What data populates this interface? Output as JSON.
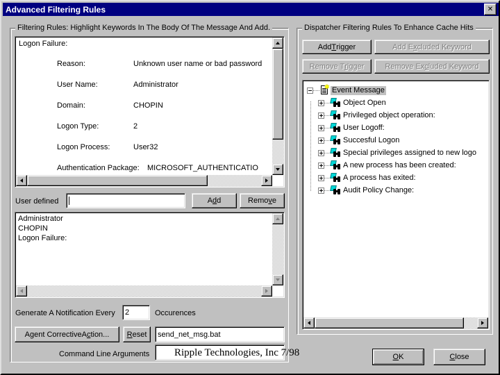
{
  "window": {
    "title": "Advanced Filtering Rules",
    "close_glyph": "✕",
    "titlebar_color": "#000080",
    "face_color": "#c0c0c0"
  },
  "left_group": {
    "title": "Filtering Rules: Highlight Keywords In The Body Of The Message And Add.",
    "message_view": {
      "header": "Logon Failure:",
      "rows": [
        {
          "label": "Reason:",
          "value": "Unknown user name or bad password"
        },
        {
          "label": "User Name:",
          "value": "Administrator"
        },
        {
          "label": "Domain:",
          "value": "CHOPIN"
        },
        {
          "label": "Logon Type:",
          "value": "2"
        },
        {
          "label": "Logon Process:",
          "value": "User32"
        },
        {
          "label": "Authentication Package:",
          "value": "MICROSOFT_AUTHENTICATIO"
        }
      ]
    },
    "user_defined_label": "User defined",
    "user_defined_value": "",
    "user_defined_placeholder": "",
    "add_button": {
      "pre": "A",
      "mnemonic": "d",
      "post": "d"
    },
    "remove_button": {
      "pre": "Remo",
      "mnemonic": "v",
      "post": "e"
    },
    "keyword_list": [
      "Administrator",
      "CHOPIN",
      "Logon Failure:"
    ],
    "notify_label": "Generate A Notification Every",
    "notify_value": "2",
    "occurrences_label": "Occurences",
    "agent_button": {
      "pre": "A",
      "mnemonic": "g",
      "post": "ent Corrective ",
      "pre2": "A",
      "mnemonic2": "c",
      "post2": "tion..."
    },
    "agent_button_text": "Agent Corrective Action...",
    "reset_button": {
      "mnemonic": "R",
      "post": "eset"
    },
    "script_value": "send_net_msg.bat",
    "command_line_label": "Command Line Arguments",
    "command_line_value": ""
  },
  "right_group": {
    "title": "Dispatcher Filtering Rules To Enhance Cache Hits",
    "buttons": [
      {
        "name": "add-trigger",
        "pre": "Add ",
        "mnemonic": "T",
        "post": "rigger",
        "disabled": false
      },
      {
        "name": "add-excluded-keyword",
        "pre": "Add E",
        "mnemonic": "x",
        "post": "cluded Keyword",
        "disabled": true
      },
      {
        "name": "remove-trigger",
        "pre": "Remove T",
        "mnemonic": "r",
        "post": "igger",
        "disabled": true
      },
      {
        "name": "remove-excluded-keyword",
        "pre": "Remove Ex",
        "mnemonic": "c",
        "post": "luded Keyword",
        "disabled": true
      }
    ],
    "tree": {
      "root": {
        "label": "Event Message",
        "icon": "document-star-icon",
        "expanded": true,
        "selected": true
      },
      "children": [
        {
          "label": "Object Open",
          "icon": "binoculars-gem-icon",
          "expanded": false
        },
        {
          "label": "Privileged object operation:",
          "icon": "binoculars-gem-icon",
          "expanded": false
        },
        {
          "label": "User Logoff:",
          "icon": "binoculars-gem-icon",
          "expanded": false
        },
        {
          "label": "Succesful Logon",
          "icon": "binoculars-gem-icon",
          "expanded": false
        },
        {
          "label": "Special privileges assigned to new logo",
          "icon": "binoculars-gem-icon",
          "expanded": false
        },
        {
          "label": "A new process has been created:",
          "icon": "binoculars-gem-icon",
          "expanded": false
        },
        {
          "label": "A process has exited:",
          "icon": "binoculars-gem-icon",
          "expanded": false
        },
        {
          "label": "Audit Policy Change:",
          "icon": "binoculars-gem-icon",
          "expanded": false
        }
      ]
    }
  },
  "footer": {
    "ok_button": {
      "mnemonic": "O",
      "post": "K"
    },
    "close_button": {
      "pre": "",
      "mnemonic": "C",
      "post": "lose"
    }
  },
  "watermark": "Ripple Technologies, Inc 7/98"
}
